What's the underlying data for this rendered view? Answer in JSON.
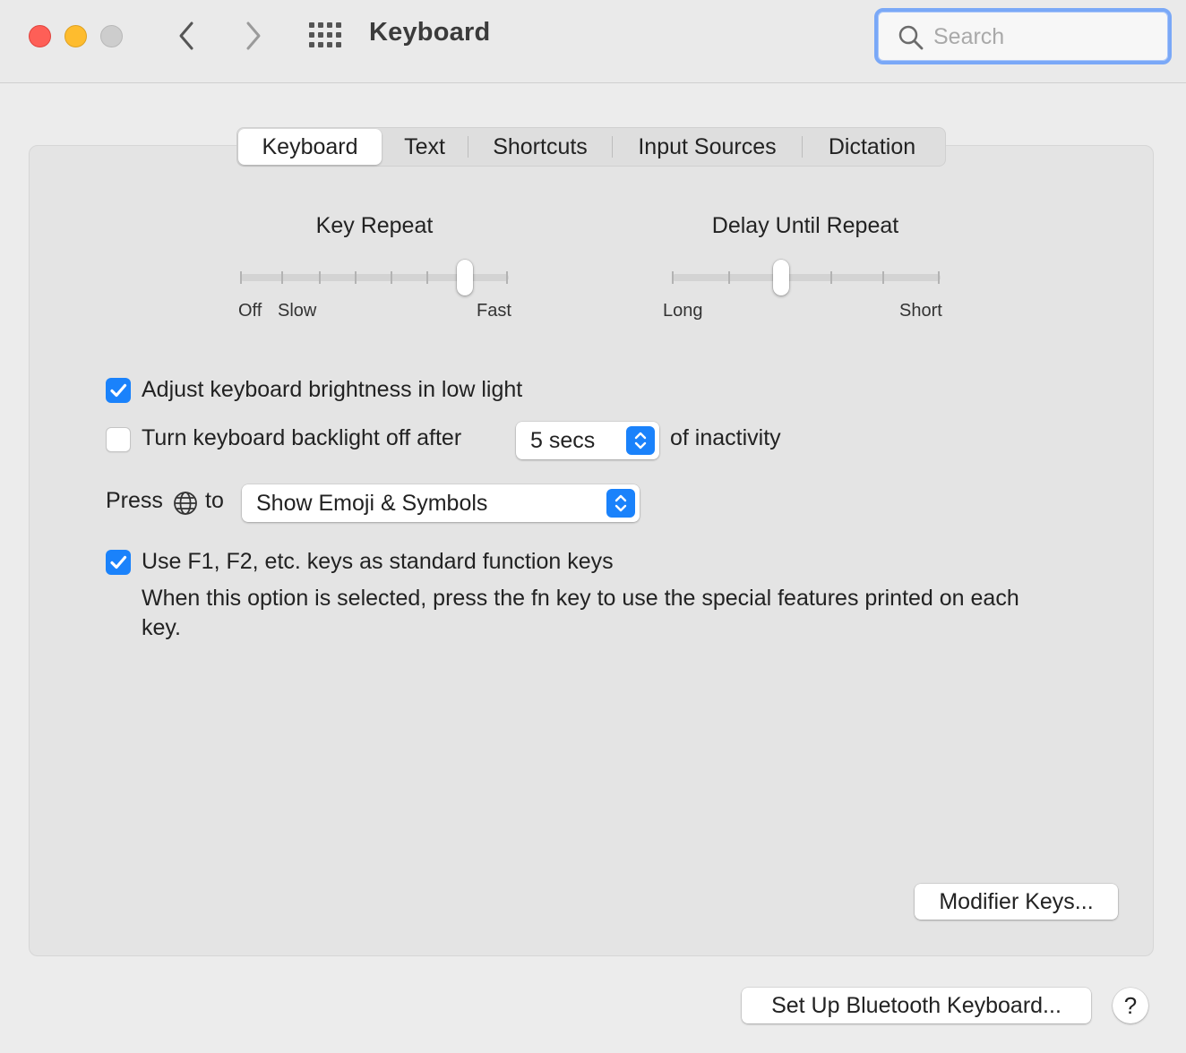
{
  "window": {
    "title": "Keyboard",
    "search_placeholder": "Search"
  },
  "tabs": [
    {
      "label": "Keyboard",
      "active": true
    },
    {
      "label": "Text",
      "active": false
    },
    {
      "label": "Shortcuts",
      "active": false
    },
    {
      "label": "Input Sources",
      "active": false
    },
    {
      "label": "Dictation",
      "active": false
    }
  ],
  "key_repeat": {
    "title": "Key Repeat",
    "labels": {
      "off": "Off",
      "slow": "Slow",
      "fast": "Fast"
    },
    "ticks": 8,
    "selected_index": 6
  },
  "delay_until_repeat": {
    "title": "Delay Until Repeat",
    "labels": {
      "long": "Long",
      "short": "Short"
    },
    "ticks": 6,
    "selected_index": 2
  },
  "options": {
    "adjust_brightness": {
      "label": "Adjust keyboard brightness in low light",
      "checked": true
    },
    "backlight_off": {
      "label": "Turn keyboard backlight off after",
      "checked": false,
      "value": "5 secs",
      "suffix": "of inactivity"
    },
    "press_globe": {
      "prefix": "Press",
      "suffix": "to",
      "value": "Show Emoji & Symbols"
    },
    "function_keys": {
      "label": "Use F1, F2, etc. keys as standard function keys",
      "checked": true,
      "description": "When this option is selected, press the fn key to use the special features printed on each key."
    }
  },
  "buttons": {
    "modifier_keys": "Modifier Keys...",
    "bluetooth_keyboard": "Set Up Bluetooth Keyboard...",
    "help": "?"
  },
  "colors": {
    "accent": "#1a82fb",
    "close": "#fe5f57",
    "minimize": "#febc2e"
  }
}
